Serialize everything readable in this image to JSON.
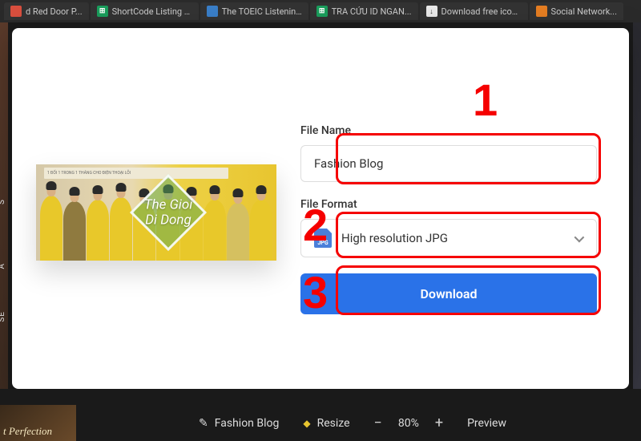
{
  "tabs": [
    {
      "label": "d Red Door P...",
      "icon_color": "red"
    },
    {
      "label": "ShortCode Listing -...",
      "icon_color": "green"
    },
    {
      "label": "The TOEIC Listening...",
      "icon_color": "blue"
    },
    {
      "label": "TRA CỨU ID NGAN...",
      "icon_color": "green"
    },
    {
      "label": "Download free icon...",
      "icon_color": "white"
    },
    {
      "label": "Social Network...",
      "icon_color": "orange"
    }
  ],
  "preview": {
    "banner_text": "1 ĐỔI 1 TRONG 1 THÁNG CHO ĐIỆN THOẠI LỖI",
    "overlay_line1": "The Gioi",
    "overlay_line2": "Di Dong"
  },
  "form": {
    "filename_label": "File Name",
    "filename_value": "Fashion Blog",
    "fileformat_label": "File Format",
    "fileformat_value": "High resolution JPG",
    "fileformat_badge": "JPG",
    "download_label": "Download"
  },
  "annotations": {
    "n1": "1",
    "n2": "2",
    "n3": "3"
  },
  "bottom": {
    "thumb_text": "t Perfection",
    "title": "Fashion Blog",
    "resize_label": "Resize",
    "zoom_value": "80%",
    "preview_label": "Preview"
  },
  "bg_strip": {
    "t1": "S",
    "t2": "A",
    "t3": "SE"
  }
}
